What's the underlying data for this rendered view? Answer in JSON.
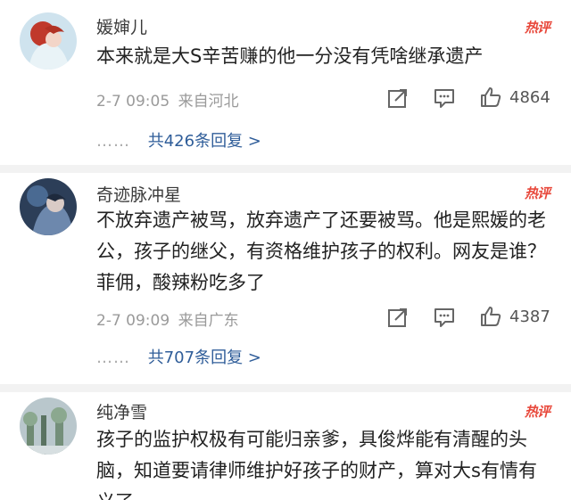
{
  "comments": [
    {
      "username": "媛婶儿",
      "hot_badge": "热评",
      "text": "本来就是大S辛苦赚的他一分没有凭啥继承遗产",
      "timestamp": "2-7 09:05",
      "location": "来自河北",
      "likes": "4864",
      "replies_dots": "……",
      "replies_link": "共426条回复 >"
    },
    {
      "username": "奇迹脉冲星",
      "hot_badge": "热评",
      "text": "不放弃遗产被骂，放弃遗产了还要被骂。他是熙媛的老公，孩子的继父，有资格维护孩子的权利。网友是谁？菲佣，酸辣粉吃多了",
      "timestamp": "2-7 09:09",
      "location": "来自广东",
      "likes": "4387",
      "replies_dots": "……",
      "replies_link": "共707条回复 >"
    },
    {
      "username": "纯净雪",
      "hot_badge": "热评",
      "text": "孩子的监护权极有可能归亲爹，具俊烨能有清醒的头脑，知道要请律师维护好孩子的财产，算对大s有情有义了",
      "timestamp": "",
      "location": "",
      "likes": ""
    }
  ],
  "icons": {
    "share": "share-icon",
    "comment": "comment-icon",
    "like": "thumbs-up-icon"
  },
  "colors": {
    "hot_badge": "#e8483b",
    "reply_link": "#2f5d99",
    "meta_text": "#9a9a9a"
  }
}
